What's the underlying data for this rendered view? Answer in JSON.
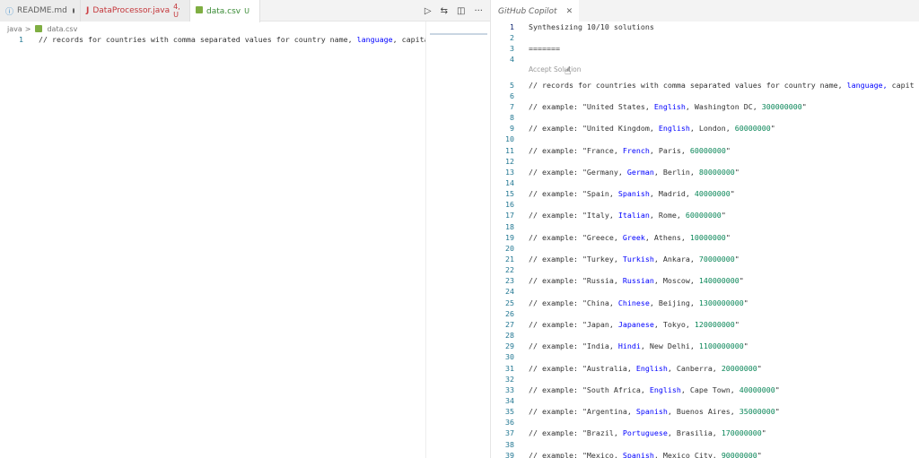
{
  "left": {
    "tabs": [
      {
        "label": "README.md",
        "status": "",
        "icon": "info-icon"
      },
      {
        "label": "DataProcessor.java",
        "status": "4, U",
        "icon": "java-icon"
      },
      {
        "label": "data.csv",
        "status": "U",
        "icon": "table-icon"
      }
    ],
    "breadcrumb": {
      "root": "java",
      "separator": ">",
      "file": "data.csv"
    },
    "code": {
      "line_number": "1",
      "text": "// records for countries with comma separated values for country name, language, capita"
    }
  },
  "right": {
    "tab_label": "GitHub Copilot",
    "accept_label": "Accept Solution",
    "header_lines": [
      {
        "n": "1",
        "text": "Synthesizing 10/10 solutions"
      },
      {
        "n": "2",
        "text": ""
      },
      {
        "n": "3",
        "text": "======="
      },
      {
        "n": "4",
        "text": ""
      }
    ],
    "record_line": {
      "n": "5",
      "prefix": "// records for countries with comma separated values for country name, ",
      "lang": "language,",
      "suffix": "   capit"
    },
    "examples": [
      {
        "n": "7",
        "country": "United States",
        "lang": "English",
        "city": "Washington DC",
        "num": "300000000"
      },
      {
        "n": "9",
        "country": "United Kingdom",
        "lang": "English",
        "city": "London",
        "num": "60000000"
      },
      {
        "n": "11",
        "country": "France",
        "lang": "French",
        "city": "Paris",
        "num": "60000000"
      },
      {
        "n": "13",
        "country": "Germany",
        "lang": "German",
        "city": "Berlin",
        "num": "80000000"
      },
      {
        "n": "15",
        "country": "Spain",
        "lang": "Spanish",
        "city": "Madrid",
        "num": "40000000"
      },
      {
        "n": "17",
        "country": "Italy",
        "lang": "Italian",
        "city": "Rome",
        "num": "60000000"
      },
      {
        "n": "19",
        "country": "Greece",
        "lang": "Greek",
        "city": "Athens",
        "num": "10000000"
      },
      {
        "n": "21",
        "country": "Turkey",
        "lang": "Turkish",
        "city": "Ankara",
        "num": "70000000"
      },
      {
        "n": "23",
        "country": "Russia",
        "lang": "Russian",
        "city": "Moscow",
        "num": "140000000"
      },
      {
        "n": "25",
        "country": "China",
        "lang": "Chinese",
        "city": "Beijing",
        "num": "1300000000"
      },
      {
        "n": "27",
        "country": "Japan",
        "lang": "Japanese",
        "city": "Tokyo",
        "num": "120000000"
      },
      {
        "n": "29",
        "country": "India",
        "lang": "Hindi",
        "city": "New Delhi",
        "num": "1100000000"
      },
      {
        "n": "31",
        "country": "Australia",
        "lang": "English",
        "city": "Canberra",
        "num": "20000000"
      },
      {
        "n": "33",
        "country": "South Africa",
        "lang": "English",
        "city": "Cape Town",
        "num": "40000000"
      },
      {
        "n": "35",
        "country": "Argentina",
        "lang": "Spanish",
        "city": "Buenos Aires",
        "num": "35000000"
      },
      {
        "n": "37",
        "country": "Brazil",
        "lang": "Portuguese",
        "city": "Brasilia",
        "num": "170000000"
      },
      {
        "n": "39",
        "country": "Mexico",
        "lang": "Spanish",
        "city": "Mexico City",
        "num": "90000000"
      }
    ],
    "blank_lines": [
      "6",
      "8",
      "10",
      "12",
      "14",
      "16",
      "18",
      "20",
      "22",
      "24",
      "26",
      "28",
      "30",
      "32",
      "34",
      "36",
      "38"
    ],
    "example_prefix": "// example: \"",
    "colors": {
      "line_number": "#237893",
      "keyword": "#0000ff",
      "number": "#098658"
    }
  }
}
